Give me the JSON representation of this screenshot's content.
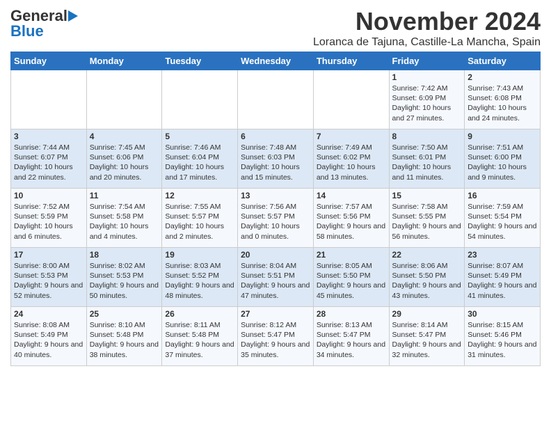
{
  "header": {
    "logo_general": "General",
    "logo_blue": "Blue",
    "month": "November 2024",
    "location": "Loranca de Tajuna, Castille-La Mancha, Spain"
  },
  "weekdays": [
    "Sunday",
    "Monday",
    "Tuesday",
    "Wednesday",
    "Thursday",
    "Friday",
    "Saturday"
  ],
  "weeks": [
    [
      {
        "day": "",
        "info": ""
      },
      {
        "day": "",
        "info": ""
      },
      {
        "day": "",
        "info": ""
      },
      {
        "day": "",
        "info": ""
      },
      {
        "day": "",
        "info": ""
      },
      {
        "day": "1",
        "info": "Sunrise: 7:42 AM\nSunset: 6:09 PM\nDaylight: 10 hours and 27 minutes."
      },
      {
        "day": "2",
        "info": "Sunrise: 7:43 AM\nSunset: 6:08 PM\nDaylight: 10 hours and 24 minutes."
      }
    ],
    [
      {
        "day": "3",
        "info": "Sunrise: 7:44 AM\nSunset: 6:07 PM\nDaylight: 10 hours and 22 minutes."
      },
      {
        "day": "4",
        "info": "Sunrise: 7:45 AM\nSunset: 6:06 PM\nDaylight: 10 hours and 20 minutes."
      },
      {
        "day": "5",
        "info": "Sunrise: 7:46 AM\nSunset: 6:04 PM\nDaylight: 10 hours and 17 minutes."
      },
      {
        "day": "6",
        "info": "Sunrise: 7:48 AM\nSunset: 6:03 PM\nDaylight: 10 hours and 15 minutes."
      },
      {
        "day": "7",
        "info": "Sunrise: 7:49 AM\nSunset: 6:02 PM\nDaylight: 10 hours and 13 minutes."
      },
      {
        "day": "8",
        "info": "Sunrise: 7:50 AM\nSunset: 6:01 PM\nDaylight: 10 hours and 11 minutes."
      },
      {
        "day": "9",
        "info": "Sunrise: 7:51 AM\nSunset: 6:00 PM\nDaylight: 10 hours and 9 minutes."
      }
    ],
    [
      {
        "day": "10",
        "info": "Sunrise: 7:52 AM\nSunset: 5:59 PM\nDaylight: 10 hours and 6 minutes."
      },
      {
        "day": "11",
        "info": "Sunrise: 7:54 AM\nSunset: 5:58 PM\nDaylight: 10 hours and 4 minutes."
      },
      {
        "day": "12",
        "info": "Sunrise: 7:55 AM\nSunset: 5:57 PM\nDaylight: 10 hours and 2 minutes."
      },
      {
        "day": "13",
        "info": "Sunrise: 7:56 AM\nSunset: 5:57 PM\nDaylight: 10 hours and 0 minutes."
      },
      {
        "day": "14",
        "info": "Sunrise: 7:57 AM\nSunset: 5:56 PM\nDaylight: 9 hours and 58 minutes."
      },
      {
        "day": "15",
        "info": "Sunrise: 7:58 AM\nSunset: 5:55 PM\nDaylight: 9 hours and 56 minutes."
      },
      {
        "day": "16",
        "info": "Sunrise: 7:59 AM\nSunset: 5:54 PM\nDaylight: 9 hours and 54 minutes."
      }
    ],
    [
      {
        "day": "17",
        "info": "Sunrise: 8:00 AM\nSunset: 5:53 PM\nDaylight: 9 hours and 52 minutes."
      },
      {
        "day": "18",
        "info": "Sunrise: 8:02 AM\nSunset: 5:53 PM\nDaylight: 9 hours and 50 minutes."
      },
      {
        "day": "19",
        "info": "Sunrise: 8:03 AM\nSunset: 5:52 PM\nDaylight: 9 hours and 48 minutes."
      },
      {
        "day": "20",
        "info": "Sunrise: 8:04 AM\nSunset: 5:51 PM\nDaylight: 9 hours and 47 minutes."
      },
      {
        "day": "21",
        "info": "Sunrise: 8:05 AM\nSunset: 5:50 PM\nDaylight: 9 hours and 45 minutes."
      },
      {
        "day": "22",
        "info": "Sunrise: 8:06 AM\nSunset: 5:50 PM\nDaylight: 9 hours and 43 minutes."
      },
      {
        "day": "23",
        "info": "Sunrise: 8:07 AM\nSunset: 5:49 PM\nDaylight: 9 hours and 41 minutes."
      }
    ],
    [
      {
        "day": "24",
        "info": "Sunrise: 8:08 AM\nSunset: 5:49 PM\nDaylight: 9 hours and 40 minutes."
      },
      {
        "day": "25",
        "info": "Sunrise: 8:10 AM\nSunset: 5:48 PM\nDaylight: 9 hours and 38 minutes."
      },
      {
        "day": "26",
        "info": "Sunrise: 8:11 AM\nSunset: 5:48 PM\nDaylight: 9 hours and 37 minutes."
      },
      {
        "day": "27",
        "info": "Sunrise: 8:12 AM\nSunset: 5:47 PM\nDaylight: 9 hours and 35 minutes."
      },
      {
        "day": "28",
        "info": "Sunrise: 8:13 AM\nSunset: 5:47 PM\nDaylight: 9 hours and 34 minutes."
      },
      {
        "day": "29",
        "info": "Sunrise: 8:14 AM\nSunset: 5:47 PM\nDaylight: 9 hours and 32 minutes."
      },
      {
        "day": "30",
        "info": "Sunrise: 8:15 AM\nSunset: 5:46 PM\nDaylight: 9 hours and 31 minutes."
      }
    ]
  ]
}
